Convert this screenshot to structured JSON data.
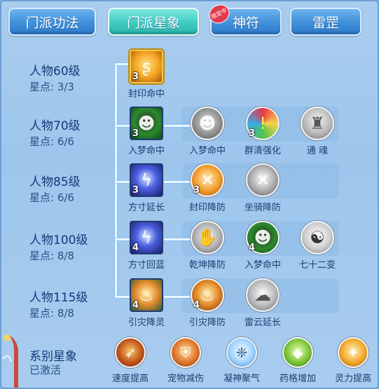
{
  "tabs": [
    {
      "label": "门派功法",
      "active": false
    },
    {
      "label": "门派星象",
      "active": true
    },
    {
      "label": "神符",
      "active": false,
      "badge": "限定中"
    },
    {
      "label": "雷罡",
      "active": false
    }
  ],
  "rows": [
    {
      "title": "人物60级",
      "stars": "星点: 3/3",
      "nodes": [
        {
          "label": "封印命中",
          "level": "3",
          "icon": "seal-hit-icon"
        }
      ]
    },
    {
      "title": "人物70级",
      "stars": "星点: 6/6",
      "nodes": [
        {
          "label": "入梦命中",
          "level": "3",
          "icon": "dream-hit-icon"
        },
        {
          "label": "入梦命中",
          "level": "",
          "icon": "dream-hit-gray-icon"
        },
        {
          "label": "群清强化",
          "level": "3",
          "icon": "group-cleanse-icon"
        },
        {
          "label": "通 魂",
          "level": "",
          "icon": "soul-link-icon"
        }
      ]
    },
    {
      "title": "人物85级",
      "stars": "星点: 6/6",
      "nodes": [
        {
          "label": "方寸延长",
          "level": "3",
          "icon": "fangcun-extend-icon"
        },
        {
          "label": "封印降防",
          "level": "3",
          "icon": "seal-defense-down-icon"
        },
        {
          "label": "坐骑降防",
          "level": "",
          "icon": "mount-defense-down-icon"
        }
      ]
    },
    {
      "title": "人物100级",
      "stars": "星点: 8/8",
      "nodes": [
        {
          "label": "方寸回蓝",
          "level": "4",
          "icon": "fangcun-mana-icon"
        },
        {
          "label": "乾坤降防",
          "level": "",
          "icon": "qiankun-defense-down-icon"
        },
        {
          "label": "入梦命中",
          "level": "4",
          "icon": "dream-hit-icon"
        },
        {
          "label": "七十二变",
          "level": "",
          "icon": "seventy-two-transform-icon"
        }
      ]
    },
    {
      "title": "人物115级",
      "stars": "星点: 8/8",
      "nodes": [
        {
          "label": "引灾降灵",
          "level": "4",
          "icon": "disaster-spirit-icon"
        },
        {
          "label": "引灾降防",
          "level": "4",
          "icon": "disaster-defense-icon"
        },
        {
          "label": "雷云延长",
          "level": "",
          "icon": "thunder-cloud-icon"
        }
      ]
    }
  ],
  "series": {
    "title": "系别星象",
    "status": "已激活",
    "items": [
      {
        "label": "速度提高",
        "icon": "speed-up-icon"
      },
      {
        "label": "宠物减伤",
        "icon": "pet-damage-reduce-icon"
      },
      {
        "label": "凝神聚气",
        "icon": "focus-qi-icon"
      },
      {
        "label": "药格增加",
        "icon": "medicine-slot-icon"
      },
      {
        "label": "灵力提高",
        "icon": "spirit-power-icon"
      }
    ]
  }
}
